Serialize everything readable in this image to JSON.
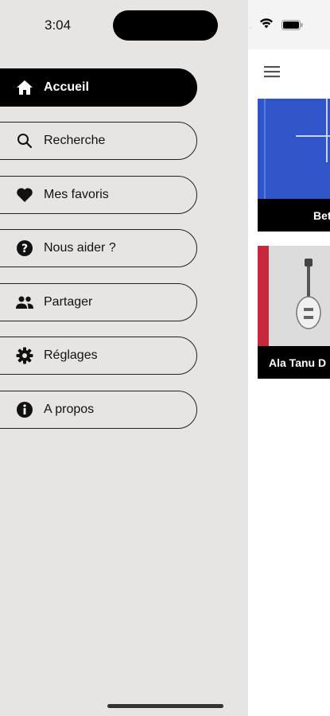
{
  "status_bar": {
    "time": "3:04"
  },
  "drawer": {
    "items": [
      {
        "label": "Accueil",
        "icon": "home-icon",
        "active": true
      },
      {
        "label": "Recherche",
        "icon": "search-icon",
        "active": false
      },
      {
        "label": "Mes favoris",
        "icon": "heart-icon",
        "active": false
      },
      {
        "label": "Nous aider ?",
        "icon": "help-icon",
        "active": false
      },
      {
        "label": "Partager",
        "icon": "people-icon",
        "active": false
      },
      {
        "label": "Réglages",
        "icon": "gear-icon",
        "active": false
      },
      {
        "label": "A propos",
        "icon": "info-icon",
        "active": false
      }
    ]
  },
  "main": {
    "menu_icon": "hamburger-icon",
    "cards": [
      {
        "caption": "Bet"
      },
      {
        "caption": "Ala Tanu D"
      }
    ]
  },
  "colors": {
    "drawer_bg": "#e6e5e3",
    "active_bg": "#000000",
    "card1_thumb": "#2f55c8",
    "card2_stripe": "#c8283c"
  }
}
